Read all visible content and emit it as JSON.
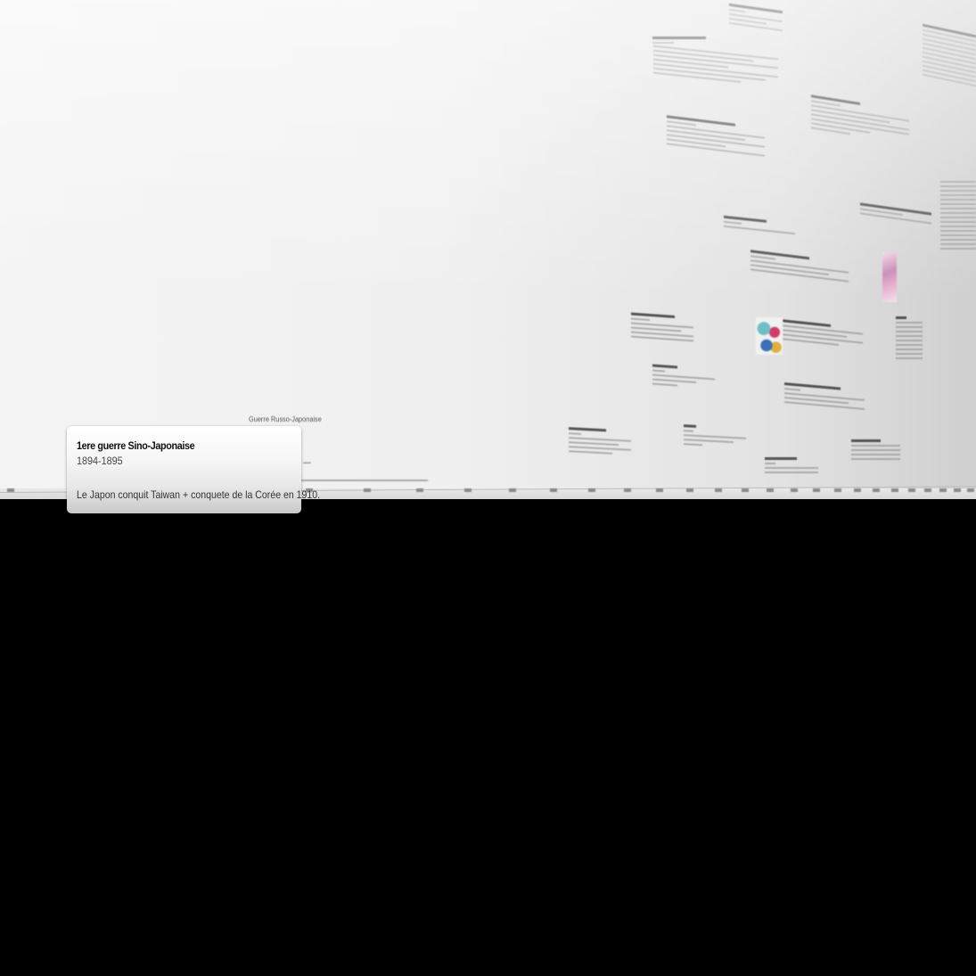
{
  "event_card": {
    "title": "1ere guerre Sino-Japonaise",
    "dates": "1894-1895",
    "description": "Le Japon conquit Taiwan + conquete de la Corée en 1910."
  },
  "background_label": "Guerre Russo-Japonaise",
  "colors": {
    "wall": "#f0f0f0",
    "card": "#f6f6f6",
    "background": "#000000"
  }
}
